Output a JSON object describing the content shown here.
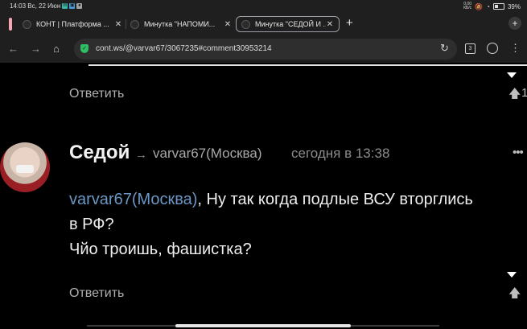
{
  "status_bar": {
    "time_date": "14:03 Вс, 22 Июн",
    "speed": "0,00\nКБ/с",
    "battery": "39%"
  },
  "tabs": [
    {
      "title": "КОНТ | Платформа ...",
      "active": false
    },
    {
      "title": "Минутка \"НАПОМИ...",
      "active": false
    },
    {
      "title": "Минутка \"СЕДОЙ И ...",
      "active": true
    }
  ],
  "toolbar": {
    "url": "cont.ws/@varvar67/3067235#comment30953214",
    "tab_count": "3"
  },
  "comments": {
    "prev_reply_label": "Ответить",
    "prev_vote_count": "1",
    "comment": {
      "author": "Седой",
      "arrow": "→",
      "recipient": "varvar67(Москва)",
      "time": "сегодня в 13:38",
      "more": "•••",
      "mention": "varvar67(Москва)",
      "line1_rest": ", Ну так когда подлые ВСУ вторглись",
      "line2": "в РФ?",
      "line3": "Чйо троишь, фашистка?",
      "reply_label": "Ответить"
    }
  },
  "icons": {
    "back": "back-arrow-icon",
    "forward": "forward-arrow-icon",
    "home": "home-icon",
    "site_info": "shield-check-icon",
    "reload": "reload-icon",
    "account": "account-icon",
    "menu": "kebab-menu-icon",
    "collapse": "collapse-triangle-icon",
    "upvote": "upvote-arrow-icon"
  },
  "colors": {
    "background": "#000000",
    "chrome": "#1f1f1f",
    "mention": "#6b97c5",
    "shield": "#2fbe63"
  }
}
